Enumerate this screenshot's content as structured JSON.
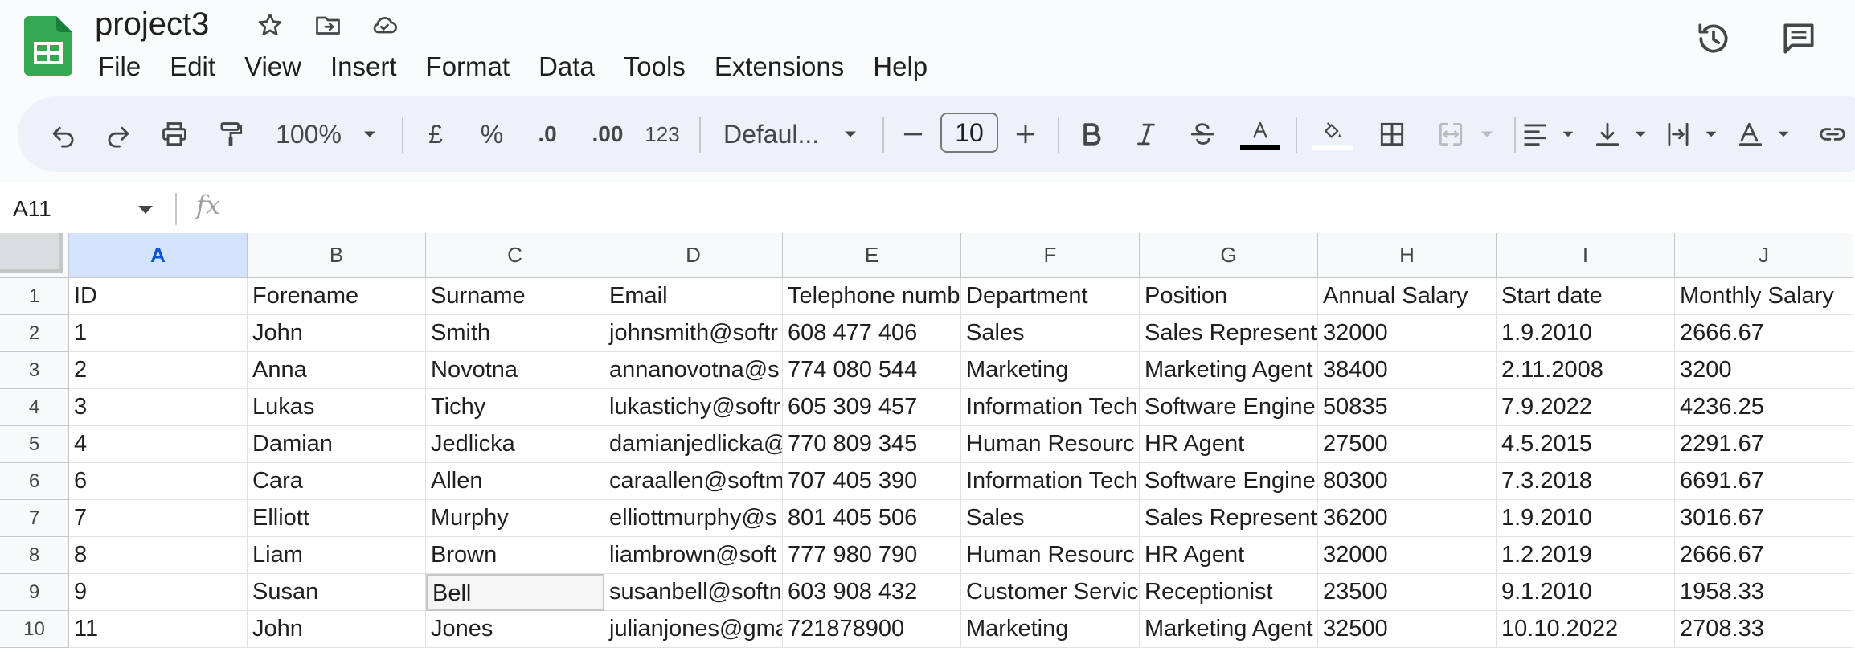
{
  "app": {
    "doc_title": "project3",
    "menu": [
      "File",
      "Edit",
      "View",
      "Insert",
      "Format",
      "Data",
      "Tools",
      "Extensions",
      "Help"
    ],
    "brand_color": "#34a853"
  },
  "toolbar": {
    "zoom": "100%",
    "currency": "£",
    "percent": "%",
    "decrease_decimal": ".0",
    "increase_decimal": ".00",
    "number_format": "123",
    "font": "Defaul...",
    "font_size": "10"
  },
  "formula_bar": {
    "name_box": "A11",
    "fx": "fx"
  },
  "sheet": {
    "columns": [
      "A",
      "B",
      "C",
      "D",
      "E",
      "F",
      "G",
      "H",
      "I",
      "J"
    ],
    "rows": [
      {
        "n": "1",
        "cells": [
          "ID",
          "Forename",
          "Surname",
          "Email",
          "Telephone numb",
          "Department",
          "Position",
          "Annual Salary",
          "Start date",
          "Monthly Salary"
        ]
      },
      {
        "n": "2",
        "cells": [
          "1",
          "John",
          "Smith",
          "johnsmith@softr",
          "608 477 406",
          "Sales",
          "Sales Represent",
          "32000",
          "1.9.2010",
          "2666.67"
        ]
      },
      {
        "n": "3",
        "cells": [
          "2",
          "Anna",
          "Novotna",
          "annanovotna@s",
          "774 080 544",
          "Marketing",
          "Marketing Agent",
          "38400",
          "2.11.2008",
          "3200"
        ]
      },
      {
        "n": "4",
        "cells": [
          "3",
          "Lukas",
          "Tichy",
          "lukastichy@softr",
          "605 309 457",
          "Information Tech",
          "Software Engine",
          "50835",
          "7.9.2022",
          "4236.25"
        ]
      },
      {
        "n": "5",
        "cells": [
          "4",
          "Damian",
          "Jedlicka",
          "damianjedlicka@",
          "770 809 345",
          "Human Resourc",
          "HR Agent",
          "27500",
          "4.5.2015",
          "2291.67"
        ]
      },
      {
        "n": "6",
        "cells": [
          "6",
          "Cara",
          "Allen",
          "caraallen@softm",
          "707 405 390",
          "Information Tech",
          "Software Engine",
          "80300",
          "7.3.2018",
          "6691.67"
        ]
      },
      {
        "n": "7",
        "cells": [
          "7",
          "Elliott",
          "Murphy",
          "elliottmurphy@s",
          "801 405 506",
          "Sales",
          "Sales Represent",
          "36200",
          "1.9.2010",
          "3016.67"
        ]
      },
      {
        "n": "8",
        "cells": [
          "8",
          "Liam",
          "Brown",
          "liambrown@soft",
          "777 980 790",
          "Human Resourc",
          "HR Agent",
          "32000",
          "1.2.2019",
          "2666.67"
        ]
      },
      {
        "n": "9",
        "cells": [
          "9",
          "Susan",
          "Bell",
          "susanbell@softn",
          "603 908 432",
          "Customer Servic",
          "Receptionist",
          "23500",
          "9.1.2010",
          "1958.33"
        ]
      },
      {
        "n": "10",
        "cells": [
          "11",
          "John",
          "Jones",
          "julianjones@gma",
          "721878900",
          "Marketing",
          "Marketing Agent",
          "32500",
          "10.10.2022",
          "2708.33"
        ]
      }
    ]
  }
}
